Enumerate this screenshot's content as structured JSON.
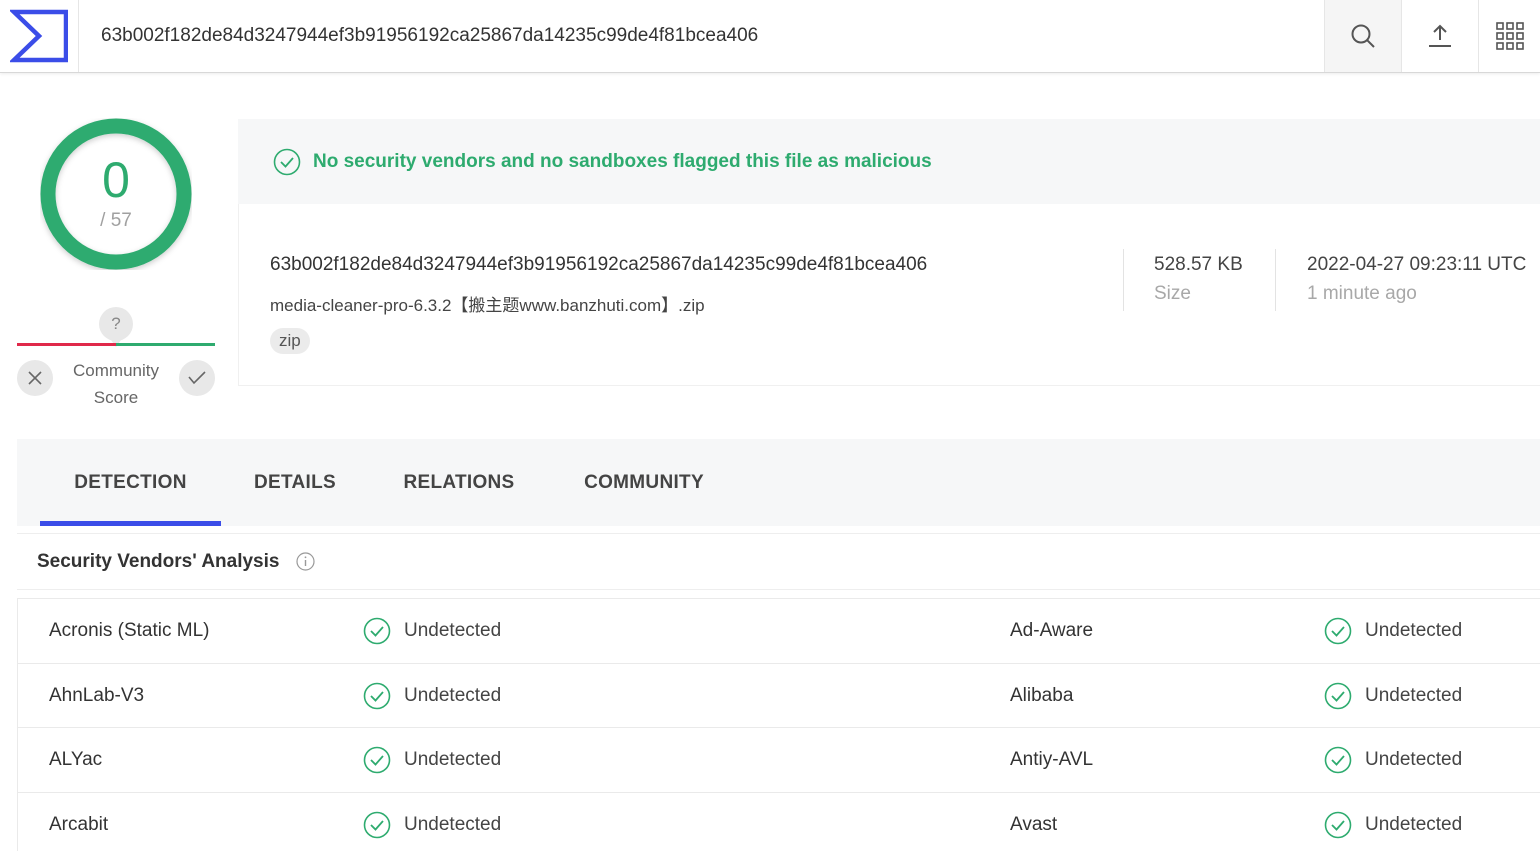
{
  "header": {
    "search_value": "63b002f182de84d3247944ef3b91956192ca25867da14235c99de4f81bcea406",
    "icons": [
      "logo-icon",
      "search-icon",
      "upload-icon",
      "apps-grid-icon"
    ]
  },
  "score": {
    "detections": "0",
    "total": "/ 57",
    "community_label_line1": "Community",
    "community_label_line2": "Score",
    "community_unknown": "?"
  },
  "banner": {
    "message": "No security vendors and no sandboxes flagged this file as malicious"
  },
  "file": {
    "hash": "63b002f182de84d3247944ef3b91956192ca25867da14235c99de4f81bcea406",
    "name": "media-cleaner-pro-6.3.2【搬主题www.banzhuti.com】.zip",
    "tag": "zip",
    "size_value": "528.57 KB",
    "size_label": "Size",
    "date_value": "2022-04-27 09:23:11 UTC",
    "date_label": "1 minute ago"
  },
  "tabs": [
    "DETECTION",
    "DETAILS",
    "RELATIONS",
    "COMMUNITY"
  ],
  "analysis": {
    "title": "Security Vendors' Analysis",
    "rows": [
      {
        "left_vendor": "Acronis (Static ML)",
        "left_status": "Undetected",
        "right_vendor": "Ad-Aware",
        "right_status": "Undetected"
      },
      {
        "left_vendor": "AhnLab-V3",
        "left_status": "Undetected",
        "right_vendor": "Alibaba",
        "right_status": "Undetected"
      },
      {
        "left_vendor": "ALYac",
        "left_status": "Undetected",
        "right_vendor": "Antiy-AVL",
        "right_status": "Undetected"
      },
      {
        "left_vendor": "Arcabit",
        "left_status": "Undetected",
        "right_vendor": "Avast",
        "right_status": "Undetected"
      }
    ]
  },
  "colors": {
    "accent": "#3b4de8",
    "clean": "#2eab6f",
    "malicious": "#e0294a"
  }
}
